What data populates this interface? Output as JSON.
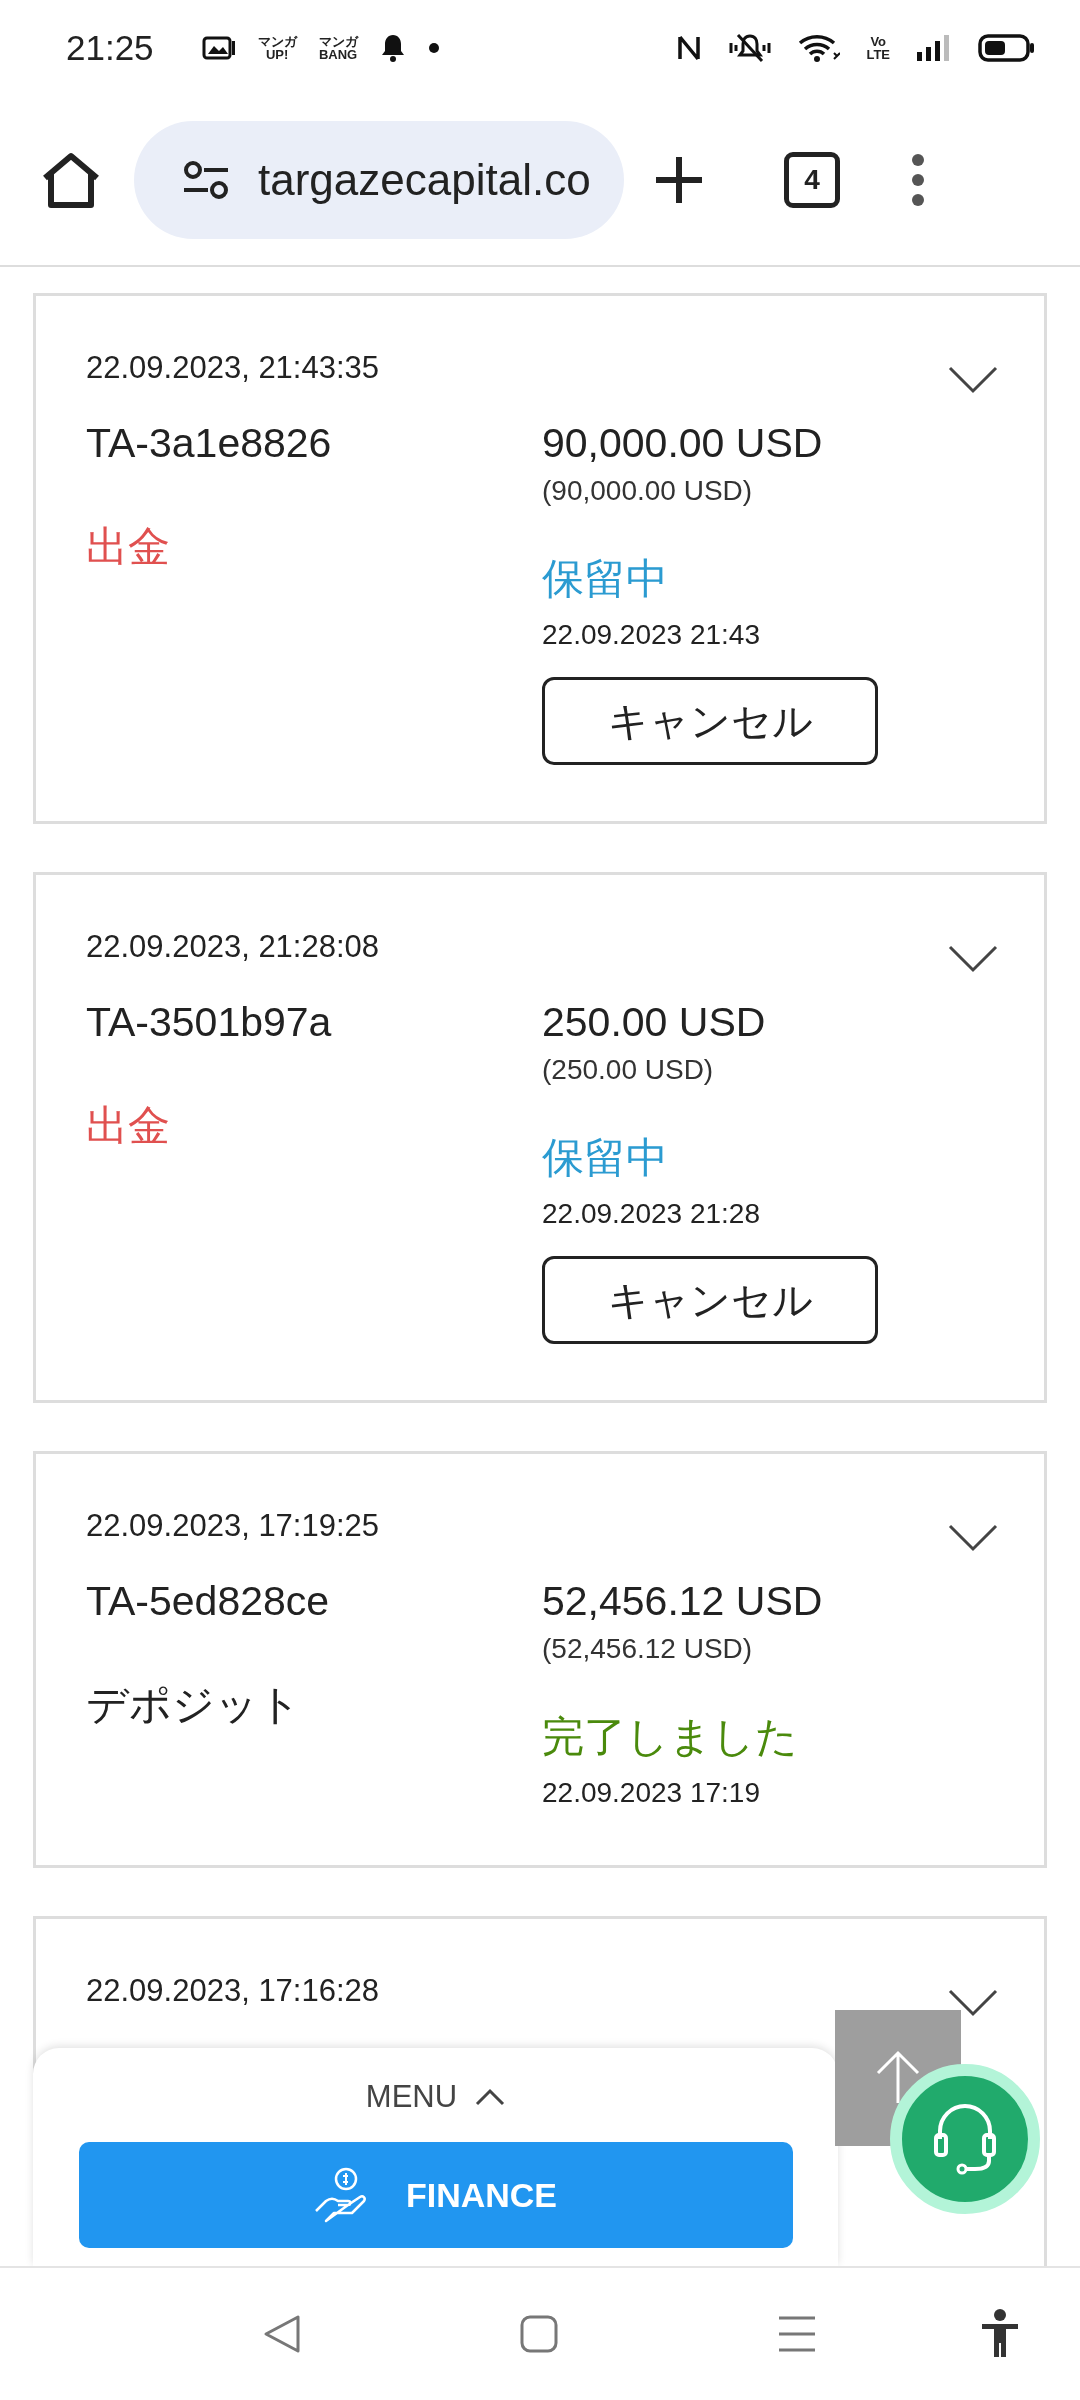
{
  "status_bar": {
    "time": "21:25",
    "app_badges": [
      {
        "top": "マンガ",
        "bottom": "UP!"
      },
      {
        "top": "マンガ",
        "bottom": "BANG"
      }
    ],
    "volte": {
      "top": "Vo",
      "bottom": "LTE"
    }
  },
  "browser": {
    "url": "targazecapital.co",
    "tab_count": "4"
  },
  "transactions": [
    {
      "datetime": "22.09.2023, 21:43:35",
      "id": "TA-3a1e8826",
      "amount": "90,000.00 USD",
      "amount_converted": "(90,000.00 USD)",
      "type": {
        "text": "出金",
        "color": "#e0504f"
      },
      "status": {
        "text": "保留中",
        "color": "#2b9bd1"
      },
      "status_time": "22.09.2023 21:43",
      "cancel_button": "キャンセル"
    },
    {
      "datetime": "22.09.2023, 21:28:08",
      "id": "TA-3501b97a",
      "amount": "250.00 USD",
      "amount_converted": "(250.00 USD)",
      "type": {
        "text": "出金",
        "color": "#e0504f"
      },
      "status": {
        "text": "保留中",
        "color": "#2b9bd1"
      },
      "status_time": "22.09.2023 21:28",
      "cancel_button": "キャンセル"
    },
    {
      "datetime": "22.09.2023, 17:19:25",
      "id": "TA-5ed828ce",
      "amount": "52,456.12 USD",
      "amount_converted": "(52,456.12 USD)",
      "type": {
        "text": "デポジット",
        "color": "#222222"
      },
      "status": {
        "text": "完了しました",
        "color": "#4a8a0c"
      },
      "status_time": "22.09.2023 17:19"
    },
    {
      "datetime": "22.09.2023, 17:16:28"
    }
  ],
  "menu": {
    "label": "MENU",
    "expanded": false,
    "finance_button": "FINANCE"
  }
}
